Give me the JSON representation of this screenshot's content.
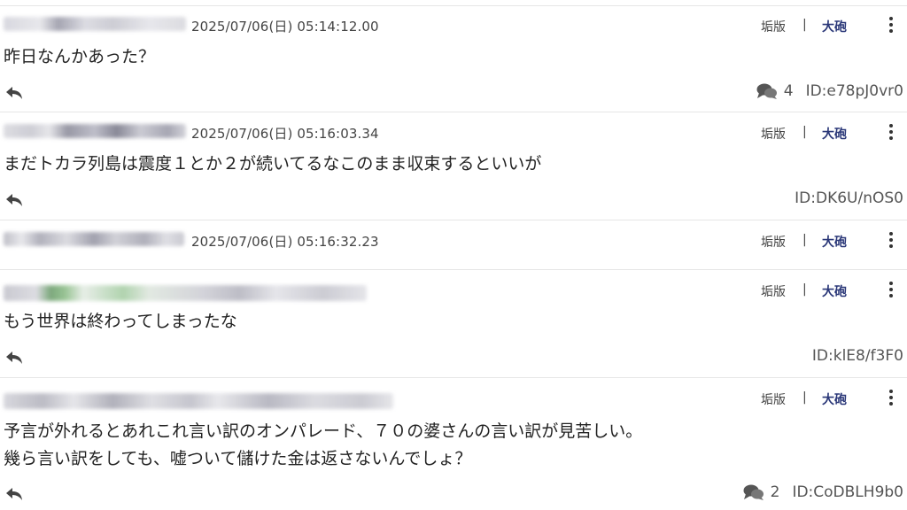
{
  "posts": [
    {
      "timestamp": "2025/07/06(日) 05:14:12.00",
      "body": [
        "昨日なんかあった？"
      ],
      "comment_count": "4",
      "id": "ID:e78pJ0vr0",
      "has_comments": true
    },
    {
      "timestamp": "2025/07/06(日) 05:16:03.34",
      "body": [
        "まだトカラ列島は震度１とか２が続いてるなこのまま収束するといいが"
      ],
      "comment_count": "",
      "id": "ID:DK6U/nOS0",
      "has_comments": false
    },
    {
      "timestamp": "2025/07/06(日) 05:16:32.23",
      "body": [],
      "comment_count": "",
      "id": "",
      "has_comments": false
    },
    {
      "timestamp": "",
      "body": [
        "もう世界は終わってしまったな"
      ],
      "comment_count": "",
      "id": "ID:klE8/f3F0",
      "has_comments": false
    },
    {
      "timestamp": "",
      "body": [
        "予言が外れるとあれこれ言い訳のオンパレード、７０の婆さんの言い訳が見苦しい。",
        "幾ら言い訳をしても、嘘ついて儲けた金は返さないんでしょ？"
      ],
      "comment_count": "2",
      "id": "ID:CoDBLH9b0",
      "has_comments": true
    }
  ],
  "actions": {
    "label_a": "垢版",
    "separator": "|",
    "label_b": "大砲"
  },
  "icons": {
    "reply": "reply-arrow-icon",
    "comments": "comments-icon",
    "menu": "kebab-menu-icon"
  },
  "colors": {
    "accent": "#2a3778",
    "divider": "#e6e6e6",
    "text": "#222222",
    "muted": "#555555"
  }
}
